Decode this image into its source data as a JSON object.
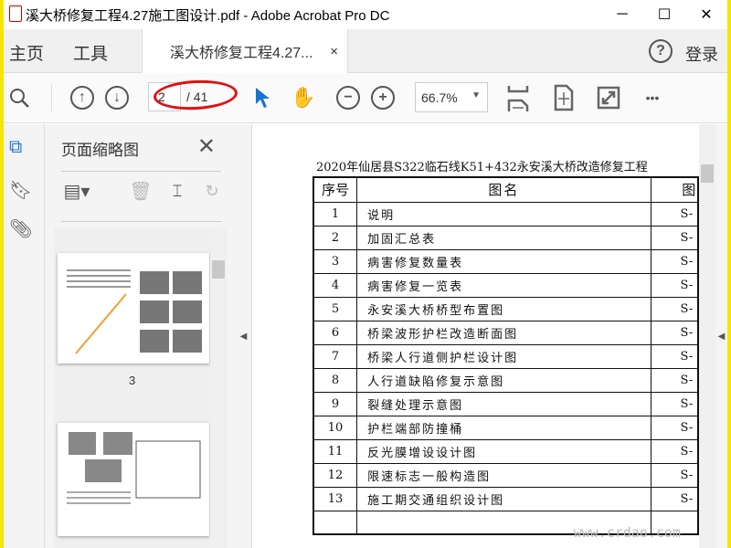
{
  "window": {
    "title": "溪大桥修复工程4.27施工图设计.pdf - Adobe Acrobat Pro DC",
    "min": "─",
    "max": "☐",
    "close": "✕"
  },
  "tabs": {
    "home": "主页",
    "tools": "工具",
    "doc": "溪大桥修复工程4.27...",
    "doc_close": "×",
    "help": "?",
    "login": "登录"
  },
  "toolbar": {
    "page_current": "2",
    "page_total": "/ 41",
    "zoom": "66.7%",
    "more": "•••"
  },
  "panel": {
    "title": "页面缩略图",
    "thumb_label": "3"
  },
  "document": {
    "heading": "2020年仙居县S322临石线K51+432永安溪大桥改造修复工程",
    "columns": [
      "序号",
      "图名",
      "图"
    ],
    "rows": [
      {
        "no": "1",
        "name": "说明",
        "code": "S-"
      },
      {
        "no": "2",
        "name": "加固汇总表",
        "code": "S-"
      },
      {
        "no": "3",
        "name": "病害修复数量表",
        "code": "S-"
      },
      {
        "no": "4",
        "name": "病害修复一览表",
        "code": "S-"
      },
      {
        "no": "5",
        "name": "永安溪大桥桥型布置图",
        "code": "S-"
      },
      {
        "no": "6",
        "name": "桥梁波形护栏改造断面图",
        "code": "S-"
      },
      {
        "no": "7",
        "name": "桥梁人行道侧护栏设计图",
        "code": "S-"
      },
      {
        "no": "8",
        "name": "人行道缺陷修复示意图",
        "code": "S-"
      },
      {
        "no": "9",
        "name": "裂缝处理示意图",
        "code": "S-"
      },
      {
        "no": "10",
        "name": "护栏端部防撞桶",
        "code": "S-"
      },
      {
        "no": "11",
        "name": "反光膜增设设计图",
        "code": "S-"
      },
      {
        "no": "12",
        "name": "限速标志一般构造图",
        "code": "S-"
      },
      {
        "no": "13",
        "name": "施工期交通组织设计图",
        "code": "S-"
      }
    ]
  },
  "watermark": "www.crdao.com"
}
